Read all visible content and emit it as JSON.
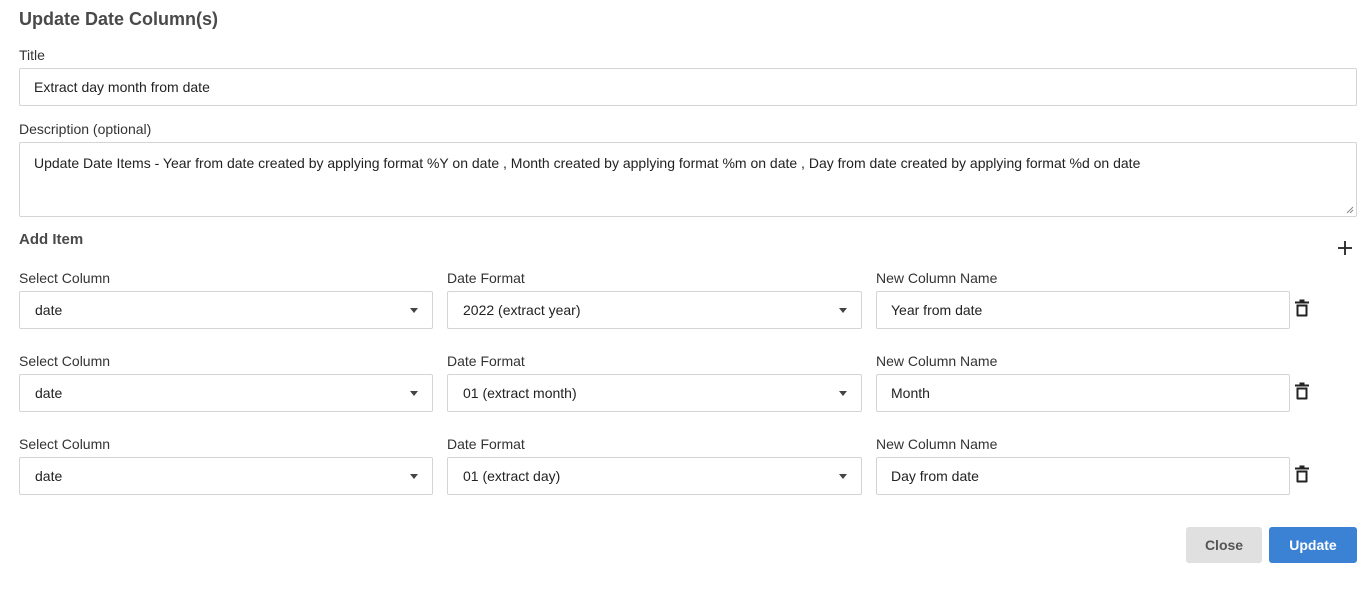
{
  "dialog": {
    "title": "Update Date Column(s)"
  },
  "form": {
    "title_label": "Title",
    "title_value": "Extract day month from date",
    "description_label": "Description (optional)",
    "description_value": "Update Date Items - Year from date created by applying format %Y on date , Month created by applying format %m on date , Day from date created by applying format %d on date"
  },
  "items_section": {
    "title": "Add Item",
    "add_icon": "plus-icon",
    "column_label": "Select Column",
    "format_label": "Date Format",
    "name_label": "New Column Name",
    "delete_icon": "trash-icon",
    "items": [
      {
        "column": "date",
        "format": "2022 (extract year)",
        "new_name": "Year from date"
      },
      {
        "column": "date",
        "format": "01 (extract month)",
        "new_name": "Month"
      },
      {
        "column": "date",
        "format": "01 (extract day)",
        "new_name": "Day from date"
      }
    ]
  },
  "footer": {
    "close_label": "Close",
    "update_label": "Update"
  },
  "colors": {
    "primary": "#3b82d4",
    "secondary": "#e0e0e0"
  }
}
